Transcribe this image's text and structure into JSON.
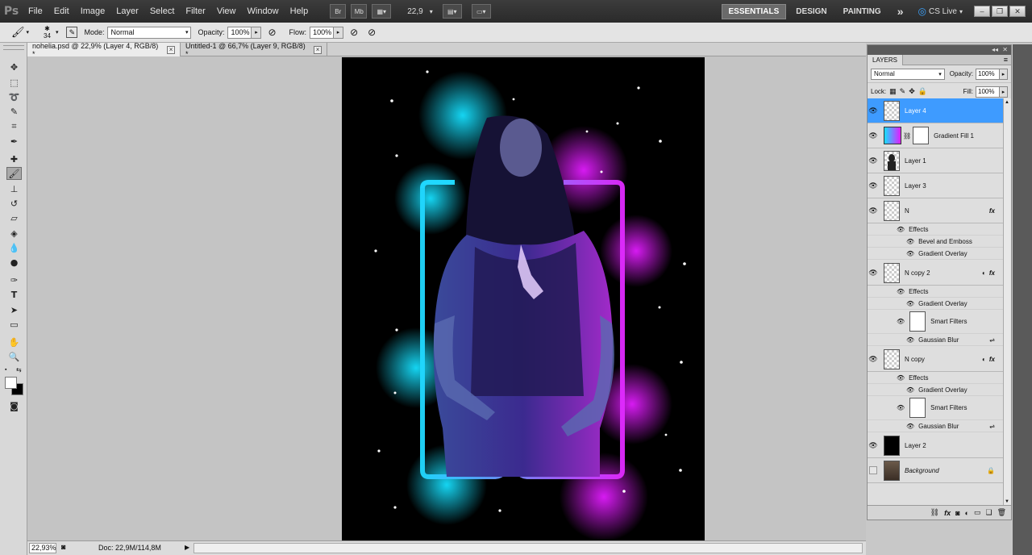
{
  "app": {
    "logo": "Ps"
  },
  "menu": [
    "File",
    "Edit",
    "Image",
    "Layer",
    "Select",
    "Filter",
    "View",
    "Window",
    "Help"
  ],
  "menubar_right": {
    "br": "Br",
    "mb": "Mb",
    "zoom": "22,9",
    "workspaces": [
      "ESSENTIALS",
      "DESIGN",
      "PAINTING"
    ],
    "more": "»",
    "cslive": "CS Live",
    "window_buttons": [
      "–",
      "❐",
      "✕"
    ]
  },
  "options": {
    "brush_size": "34",
    "mode_label": "Mode:",
    "mode_value": "Normal",
    "opacity_label": "Opacity:",
    "opacity_value": "100%",
    "flow_label": "Flow:",
    "flow_value": "100%"
  },
  "tabs": [
    {
      "label": "nohelia.psd @ 22,9% (Layer 4, RGB/8) *",
      "close": "×"
    },
    {
      "label": "Untitled-1 @ 66,7% (Layer 9, RGB/8) *",
      "close": "×"
    }
  ],
  "status": {
    "zoom": "22,93%",
    "doc": "Doc: 22,9M/114,8M",
    "arrow": "▶"
  },
  "layers_panel": {
    "tab": "LAYERS",
    "blend": "Normal",
    "opacity_label": "Opacity:",
    "opacity_value": "100%",
    "lock_label": "Lock:",
    "fill_label": "Fill:",
    "fill_value": "100%",
    "layers": [
      {
        "name": "Layer 4"
      },
      {
        "name": "Gradient Fill 1"
      },
      {
        "name": "Layer 1"
      },
      {
        "name": "Layer 3"
      },
      {
        "name": "N",
        "fx": "fx",
        "effects_label": "Effects",
        "effects": [
          "Bevel and Emboss",
          "Gradient Overlay"
        ]
      },
      {
        "name": "N copy 2",
        "fx": "fx",
        "effects_label": "Effects",
        "effects": [
          "Gradient Overlay"
        ],
        "smart_filters": "Smart Filters",
        "filter": "Gaussian Blur"
      },
      {
        "name": "N copy",
        "fx": "fx",
        "effects_label": "Effects",
        "effects": [
          "Gradient Overlay"
        ],
        "smart_filters": "Smart Filters",
        "filter": "Gaussian Blur"
      },
      {
        "name": "Layer 2"
      },
      {
        "name": "Background"
      }
    ],
    "bottom_icons": [
      "link-icon",
      "fx-icon",
      "mask-icon",
      "adjustment-icon",
      "folder-icon",
      "new-layer-icon",
      "trash-icon"
    ]
  },
  "colors": {
    "selected_layer": "#3e9bff",
    "glow_cyan": "#16e0ff",
    "glow_magenta": "#e21cff"
  }
}
